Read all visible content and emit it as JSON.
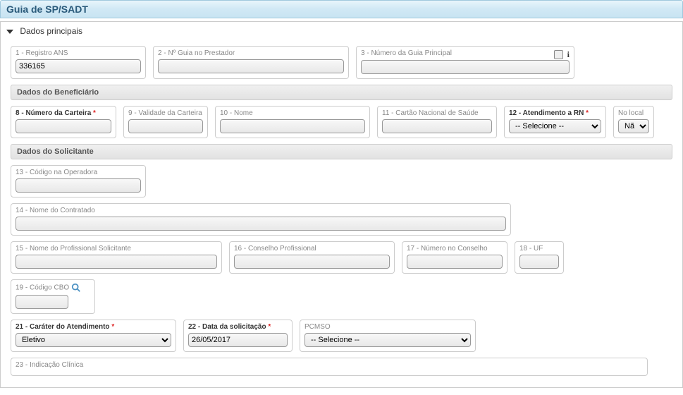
{
  "title": "Guia de SP/SADT",
  "section": {
    "main": "Dados principais"
  },
  "subsections": {
    "beneficiario": "Dados do Beneficiário",
    "solicitante": "Dados do Solicitante"
  },
  "fields": {
    "registro_ans": {
      "label": "1 - Registro ANS",
      "value": "336165"
    },
    "n_guia_prestador": {
      "label": "2 - Nº Guia no Prestador",
      "value": ""
    },
    "n_guia_principal": {
      "label": "3 - Número da Guia Principal",
      "value": ""
    },
    "numero_carteira": {
      "label": "8 - Número da Carteira",
      "value": "",
      "required": true
    },
    "validade_carteira": {
      "label": "9 - Validade da Carteira",
      "value": ""
    },
    "nome": {
      "label": "10 - Nome",
      "value": ""
    },
    "cns": {
      "label": "11 - Cartão Nacional de Saúde",
      "value": ""
    },
    "atendimento_rn": {
      "label": "12 - Atendimento a RN",
      "value": "-- Selecione --",
      "required": true
    },
    "no_local": {
      "label": "No local",
      "value": "Não"
    },
    "codigo_operadora": {
      "label": "13 - Código na Operadora",
      "value": ""
    },
    "nome_contratado": {
      "label": "14 - Nome do Contratado",
      "value": ""
    },
    "nome_profissional": {
      "label": "15 - Nome do Profissional Solicitante",
      "value": ""
    },
    "conselho_profissional": {
      "label": "16 - Conselho Profissional",
      "value": ""
    },
    "numero_conselho": {
      "label": "17 - Número no Conselho",
      "value": ""
    },
    "uf": {
      "label": "18 - UF",
      "value": ""
    },
    "codigo_cbo": {
      "label": "19 - Código CBO",
      "value": ""
    },
    "carater_atendimento": {
      "label": "21 - Caráter do Atendimento",
      "value": "Eletivo",
      "required": true
    },
    "data_solicitacao": {
      "label": "22 - Data da solicitação",
      "value": "26/05/2017",
      "required": true
    },
    "pcmso": {
      "label": "PCMSO",
      "value": "-- Selecione --"
    },
    "indicacao_clinica": {
      "label": "23 - Indicação Clínica",
      "value": ""
    }
  }
}
